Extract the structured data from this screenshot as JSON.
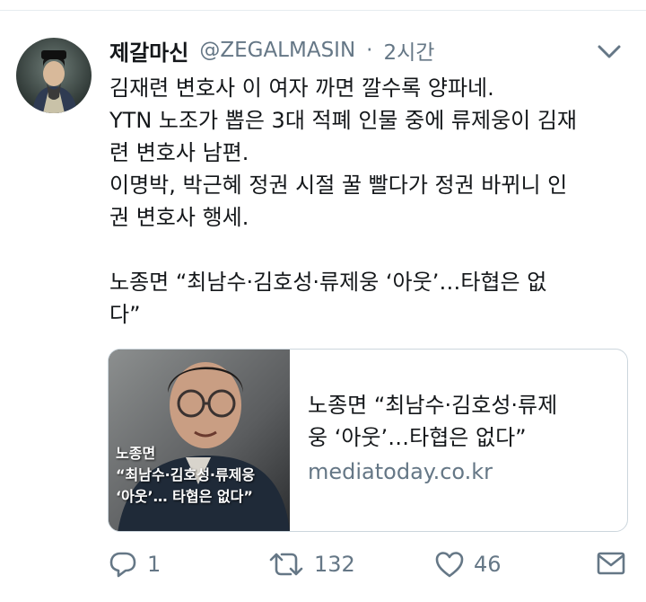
{
  "tweet": {
    "display_name": "제갈마신",
    "handle": "@ZEGALMASIN",
    "separator": "·",
    "time": "2시간",
    "lines": [
      "김재련 변호사 이 여자 까면 깔수록 양파네.",
      "YTN 노조가 뽑은 3대 적폐 인물 중에 류제웅이 김재",
      "련 변호사 남편.",
      "이명박, 박근혜 정권 시절 꿀 빨다가 정권 바뀌니 인",
      "권 변호사 행세.",
      "",
      "노종면 “최남수·김호성·류제웅 ‘아웃’…타협은 없",
      "다”"
    ]
  },
  "card": {
    "overlay_line1": "노종면",
    "overlay_line2": "“최남수·김호성·류제웅",
    "overlay_line3": "‘아웃’… 타협은 없다”",
    "title_line1": "노종면 “최남수·김호성·류제",
    "title_line2": "웅 ‘아웃’…타협은 없다”",
    "domain": "mediatoday.co.kr"
  },
  "actions": {
    "reply_count": "1",
    "retweet_count": "132",
    "like_count": "46"
  },
  "icons": {
    "reply": "reply-icon",
    "retweet": "retweet-icon",
    "like": "heart-icon",
    "dm": "envelope-icon",
    "menu": "chevron-down-icon"
  },
  "colors": {
    "text": "#14171a",
    "secondary": "#657786",
    "border": "#ccd6dd"
  }
}
